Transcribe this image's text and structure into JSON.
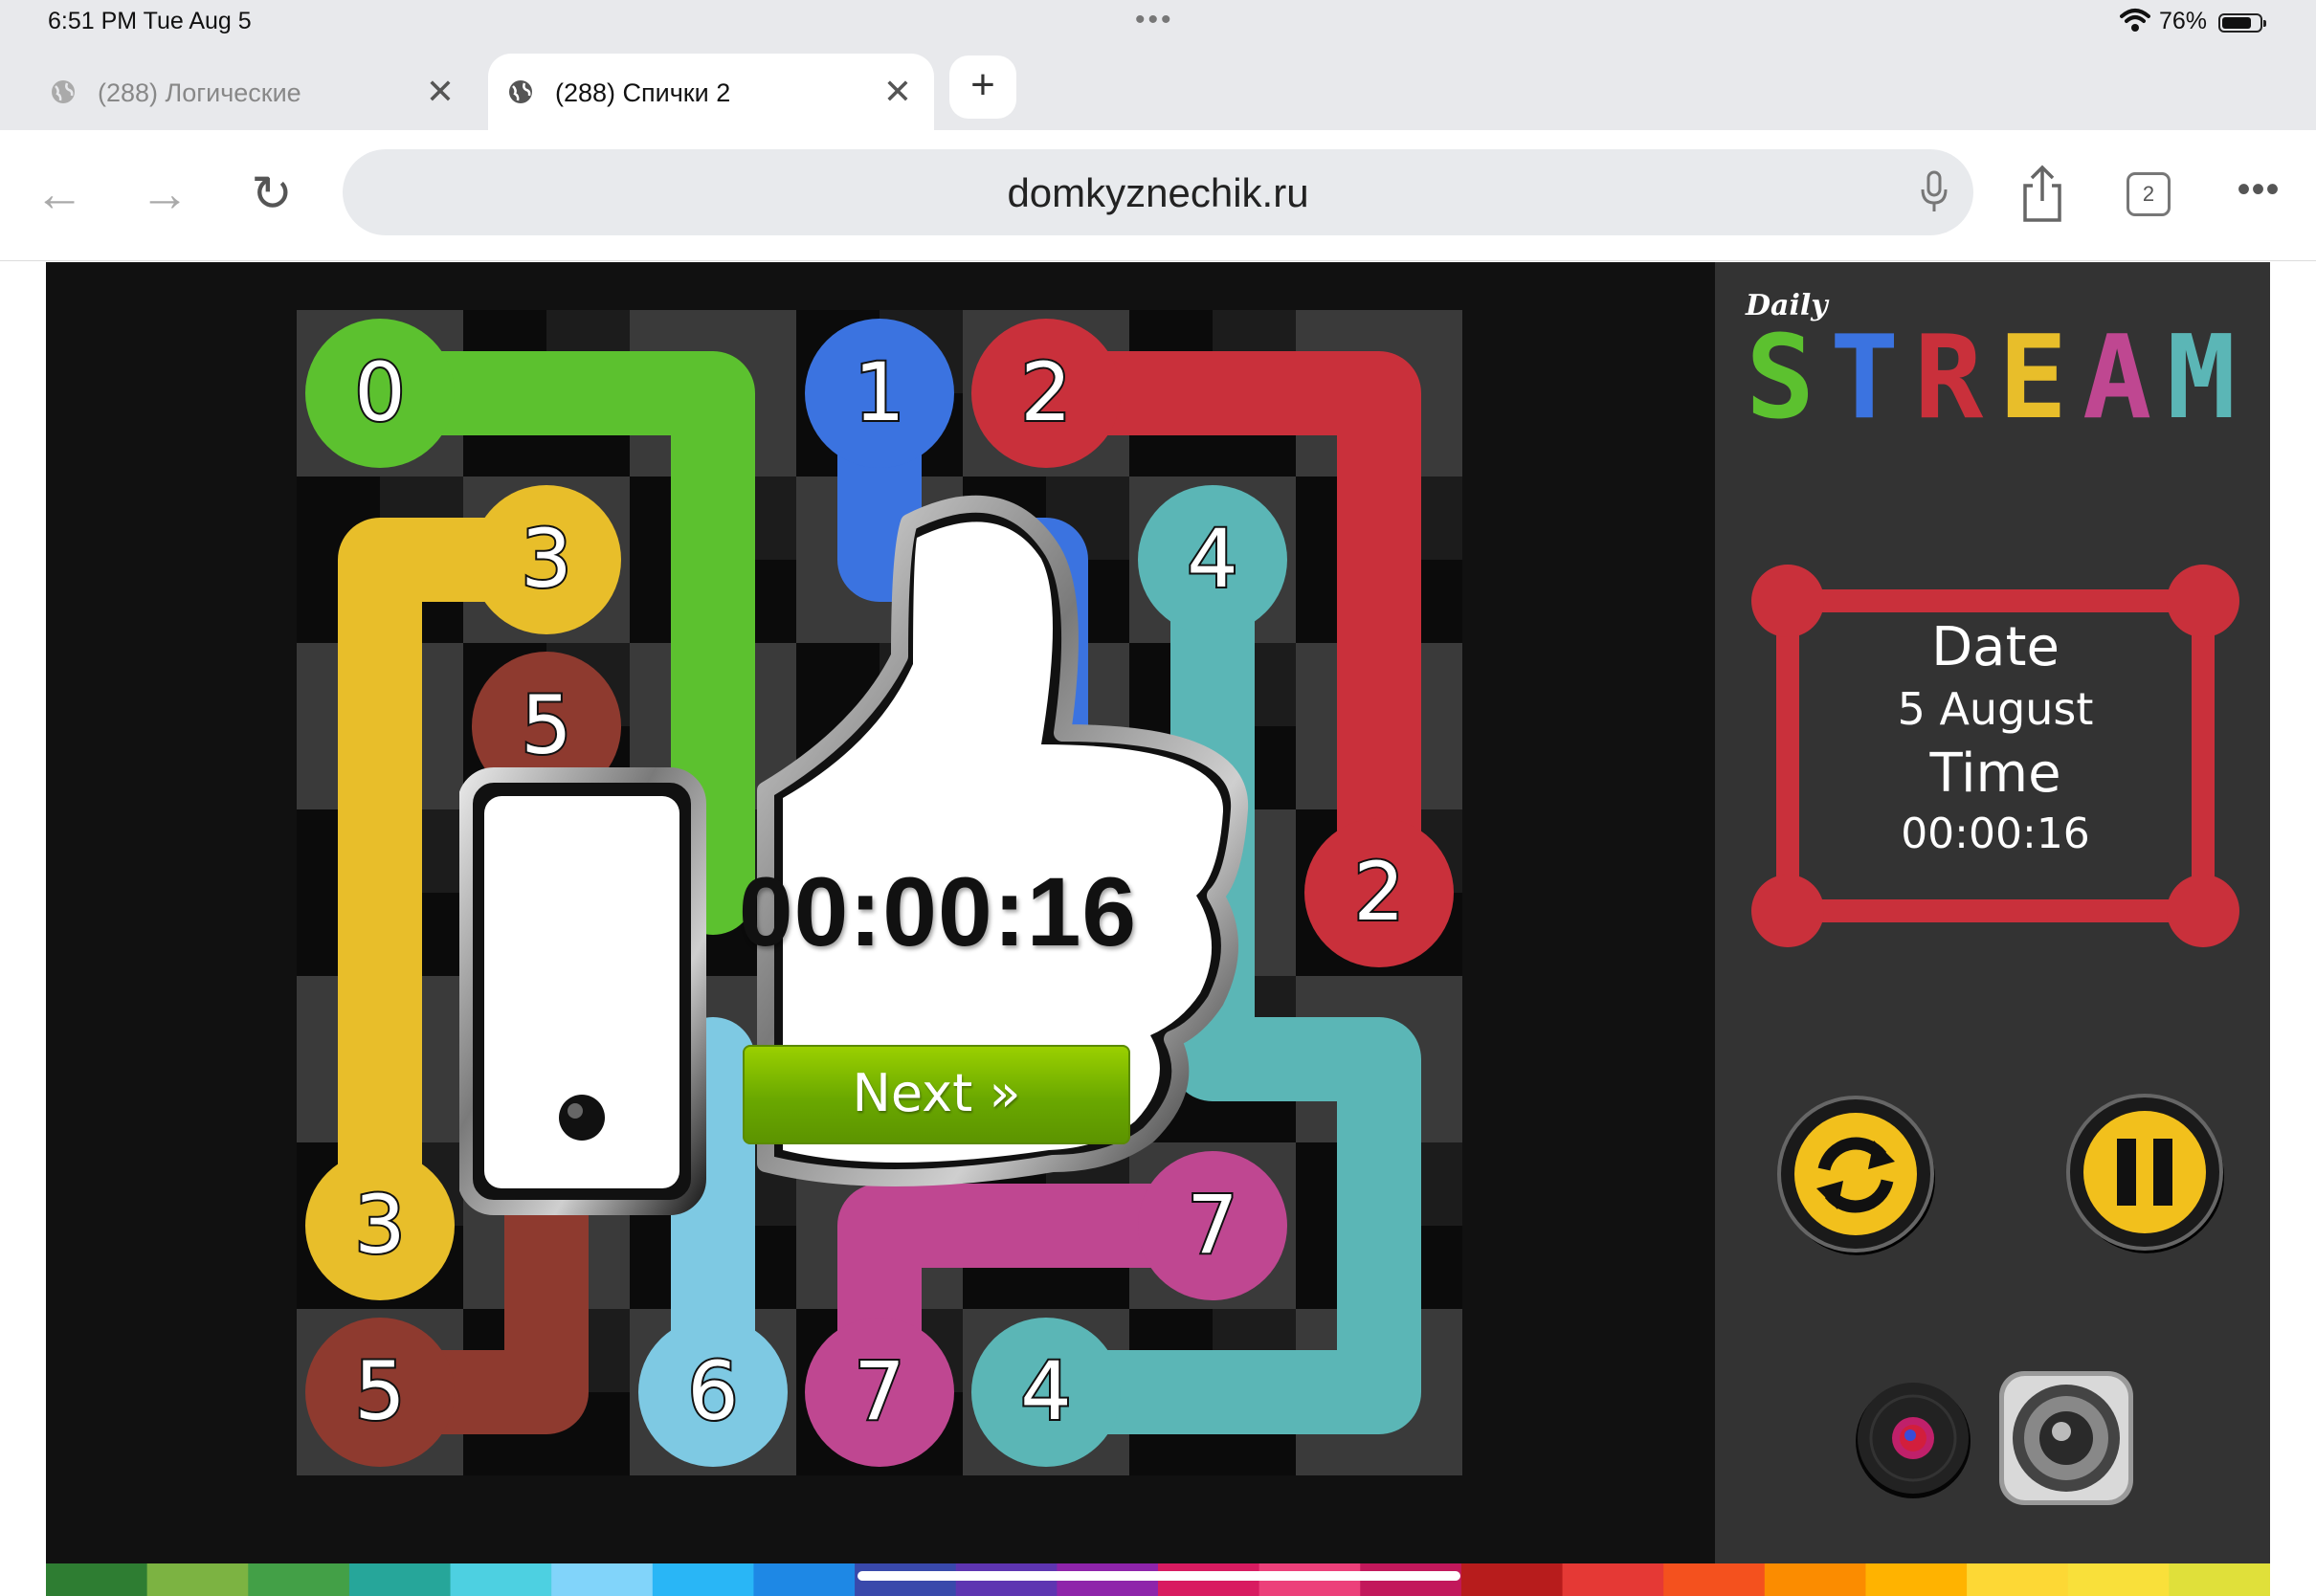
{
  "status_bar": {
    "time": "6:51 PM   Tue Aug 5",
    "more": "•••",
    "battery": "76%"
  },
  "tabs": [
    {
      "label": "(288) Логические",
      "active": false
    },
    {
      "label": "(288) Спички 2",
      "active": true
    }
  ],
  "new_tab_symbol": "+",
  "toolbar": {
    "url": "domkyznechik.ru",
    "tab_count": "2",
    "more": "•••"
  },
  "game": {
    "logo_small": "Daily",
    "logo_letters": [
      {
        "ch": "S",
        "color": "#5cc12f"
      },
      {
        "ch": "T",
        "color": "#3b73e0"
      },
      {
        "ch": "R",
        "color": "#c9303b"
      },
      {
        "ch": "E",
        "color": "#e8be2a"
      },
      {
        "ch": "A",
        "color": "#bf4791"
      },
      {
        "ch": "M",
        "color": "#5bb6b6"
      }
    ],
    "date_label": "Date",
    "date_value": "5 August",
    "time_label": "Time",
    "time_value": "00:00:16",
    "finish_time": "00:00:16",
    "next_label": "Next »",
    "endpoints": [
      {
        "num": "0",
        "color": "#5cc12f",
        "col": 0,
        "row": 0
      },
      {
        "num": "1",
        "color": "#3b73e0",
        "col": 3,
        "row": 0
      },
      {
        "num": "2",
        "color": "#c9303b",
        "col": 4,
        "row": 0
      },
      {
        "num": "3",
        "color": "#e8be2a",
        "col": 1,
        "row": 1
      },
      {
        "num": "4",
        "color": "#5bb6b6",
        "col": 5,
        "row": 1
      },
      {
        "num": "5",
        "color": "#8e3a2f",
        "col": 1,
        "row": 2
      },
      {
        "num": "2",
        "color": "#c9303b",
        "col": 6,
        "row": 3
      },
      {
        "num": "3",
        "color": "#e8be2a",
        "col": 0,
        "row": 5
      },
      {
        "num": "7",
        "color": "#bf4791",
        "col": 5,
        "row": 5
      },
      {
        "num": "5",
        "color": "#8e3a2f",
        "col": 0,
        "row": 6
      },
      {
        "num": "6",
        "color": "#7ec9e3",
        "col": 2,
        "row": 6
      },
      {
        "num": "7",
        "color": "#bf4791",
        "col": 3,
        "row": 6
      },
      {
        "num": "4",
        "color": "#5bb6b6",
        "col": 4,
        "row": 6
      }
    ],
    "paths": [
      {
        "color": "#5cc12f",
        "cells": [
          [
            0,
            0
          ],
          [
            1,
            0
          ],
          [
            2,
            0
          ],
          [
            2,
            1
          ],
          [
            2,
            2
          ],
          [
            2,
            3
          ]
        ]
      },
      {
        "color": "#3b73e0",
        "cells": [
          [
            3,
            0
          ],
          [
            3,
            1
          ],
          [
            4,
            1
          ],
          [
            4,
            2
          ]
        ]
      },
      {
        "color": "#c9303b",
        "cells": [
          [
            4,
            0
          ],
          [
            5,
            0
          ],
          [
            6,
            0
          ],
          [
            6,
            1
          ],
          [
            6,
            2
          ],
          [
            6,
            3
          ]
        ]
      },
      {
        "color": "#e8be2a",
        "cells": [
          [
            1,
            1
          ],
          [
            0,
            1
          ],
          [
            0,
            2
          ],
          [
            0,
            3
          ],
          [
            0,
            4
          ],
          [
            0,
            5
          ]
        ]
      },
      {
        "color": "#5bb6b6",
        "cells": [
          [
            5,
            1
          ],
          [
            5,
            2
          ],
          [
            5,
            3
          ],
          [
            5,
            4
          ],
          [
            6,
            4
          ],
          [
            6,
            5
          ],
          [
            6,
            6
          ],
          [
            5,
            6
          ],
          [
            4,
            6
          ]
        ]
      },
      {
        "color": "#8e3a2f",
        "cells": [
          [
            1,
            2
          ],
          [
            1,
            3
          ],
          [
            1,
            4
          ],
          [
            1,
            5
          ],
          [
            1,
            6
          ],
          [
            0,
            6
          ]
        ]
      },
      {
        "color": "#7ec9e3",
        "cells": [
          [
            2,
            6
          ],
          [
            2,
            5
          ],
          [
            2,
            4
          ]
        ]
      },
      {
        "color": "#bf4791",
        "cells": [
          [
            3,
            6
          ],
          [
            3,
            5
          ],
          [
            4,
            5
          ],
          [
            5,
            5
          ]
        ]
      }
    ],
    "strip_colors": [
      "#2e7d32",
      "#7cb342",
      "#43a047",
      "#26a69a",
      "#4dd0e1",
      "#81d4fa",
      "#29b6f6",
      "#1e88e5",
      "#3949ab",
      "#5e35b1",
      "#8e24aa",
      "#d81b60",
      "#ec407a",
      "#c2185b",
      "#b71c1c",
      "#e53935",
      "#f4511e",
      "#fb8c00",
      "#ffb300",
      "#fdd835",
      "#f9e03a",
      "#e0e03a"
    ]
  }
}
